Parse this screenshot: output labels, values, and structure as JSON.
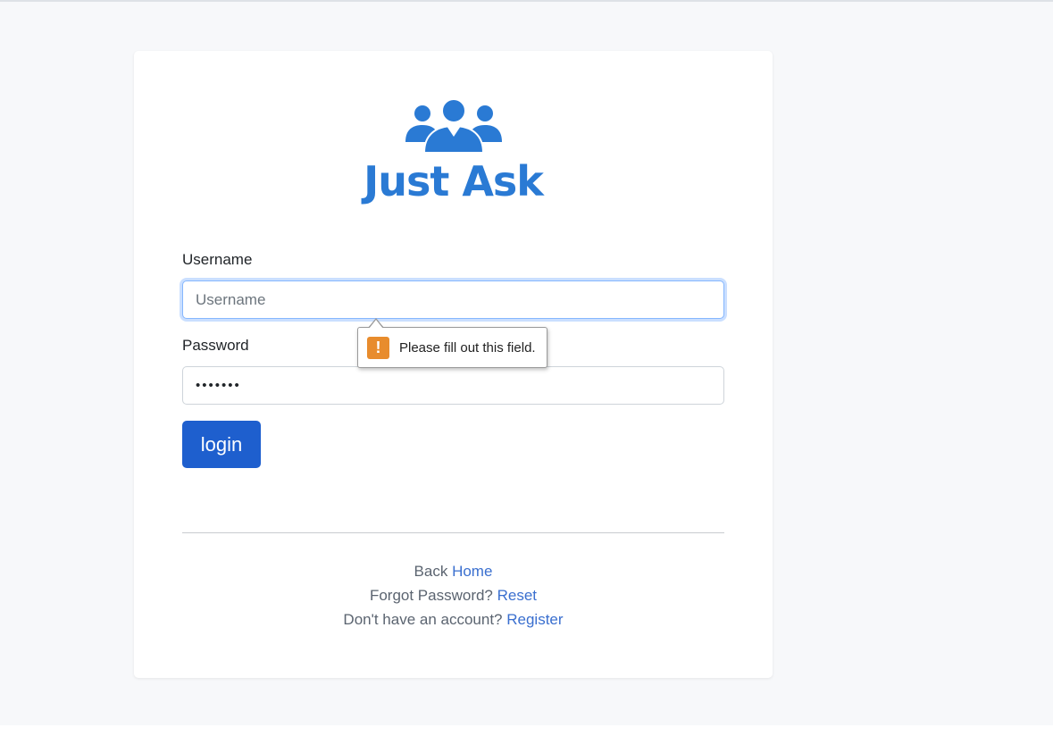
{
  "brand": {
    "name": "Just Ask",
    "color": "#2a7ad4",
    "icon": "people-group-icon"
  },
  "form": {
    "username_label": "Username",
    "username_placeholder": "Username",
    "username_value": "",
    "password_label": "Password",
    "password_value": "•••••••",
    "login_label": "login"
  },
  "validation": {
    "message": "Please fill out this field.",
    "icon": "warning-icon",
    "icon_glyph": "!"
  },
  "links": {
    "back_text": "Back",
    "home_link": "Home",
    "forgot_text": "Forgot Password?",
    "reset_link": "Reset",
    "register_text": "Don't have an account?",
    "register_link": "Register"
  },
  "colors": {
    "accent": "#1e5fce",
    "link": "#3a6fcf",
    "warning": "#e88c2d"
  }
}
